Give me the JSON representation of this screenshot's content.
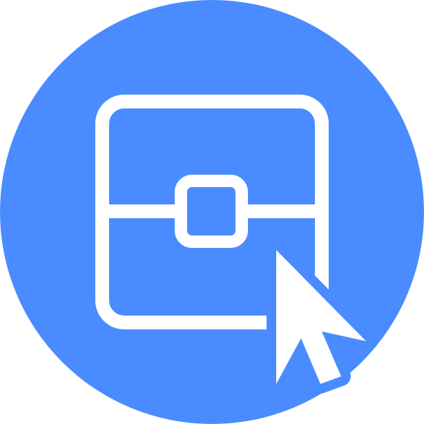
{
  "icon": {
    "name": "box-select-cursor-icon",
    "parts": [
      "rounded-square-frame",
      "horizontal-divider",
      "center-handle-square",
      "mouse-pointer-cursor"
    ]
  },
  "colors": {
    "badge_background": "#4a8cff",
    "foreground": "#ffffff",
    "page_background": "#ffffff"
  }
}
